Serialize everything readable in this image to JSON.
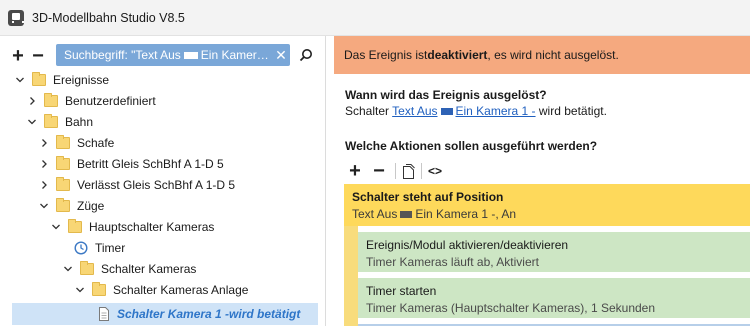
{
  "window": {
    "title": "3D-Modellbahn Studio V8.5"
  },
  "left_panel": {
    "add_label": "+",
    "remove_label": "−",
    "search_chip": {
      "prefix": "Suchbegriff: \"Text Aus",
      "suffix": "Ein Kamer…"
    },
    "tree": [
      {
        "label": "Ereignisse",
        "level": 0,
        "expanded": true
      },
      {
        "label": "Benutzerdefiniert",
        "level": 1,
        "expanded": false
      },
      {
        "label": "Bahn",
        "level": 1,
        "expanded": true
      },
      {
        "label": "Schafe",
        "level": 2,
        "expanded": false
      },
      {
        "label": "Betritt Gleis SchBhf A 1-D 5",
        "level": 2,
        "expanded": false
      },
      {
        "label": "Verlässt Gleis SchBhf A 1-D 5",
        "level": 2,
        "expanded": false
      },
      {
        "label": "Züge",
        "level": 2,
        "expanded": true
      },
      {
        "label": "Hauptschalter Kameras",
        "level": 3,
        "expanded": true
      },
      {
        "label": "Timer",
        "level": 4,
        "expanded": false
      },
      {
        "label": "Schalter Kameras",
        "level": 4,
        "expanded": true
      },
      {
        "label": "Schalter Kameras Anlage",
        "level": 5,
        "expanded": true
      },
      {
        "label": "Schalter Kamera 1 -wird betätigt",
        "level": 6,
        "selected": true
      }
    ]
  },
  "right_panel": {
    "banner": {
      "pre": "Das Ereignis ist ",
      "bold": "deaktiviert",
      "post": ", es wird nicht ausgelöst."
    },
    "question1": "Wann wird das Ereignis ausgelöst?",
    "trigger": {
      "pre": "Schalter ",
      "link_a": "Text Aus",
      "link_b": "Ein Kamera 1 -",
      "post": " wird betätigt."
    },
    "question2": "Welche Aktionen sollen ausgeführt werden?",
    "toolbar": {
      "add": "+",
      "remove": "−",
      "code": "<>"
    },
    "condition": {
      "title": "Schalter steht auf Position",
      "sub_a": "Text Aus",
      "sub_b": "Ein Kamera 1 -, An"
    },
    "actions": [
      {
        "title": "Ereignis/Modul aktivieren/deaktivieren",
        "sub": "Timer Kameras läuft ab, Aktiviert"
      },
      {
        "title": "Timer starten",
        "sub": "Timer Kameras (Hauptschalter Kameras), 1 Sekunden"
      }
    ]
  },
  "colors": {
    "banner": "#f5a97f",
    "condition": "#fed95b",
    "action": "#cde6c4",
    "selection": "#cfe3f7",
    "link": "#1f5fbf"
  }
}
